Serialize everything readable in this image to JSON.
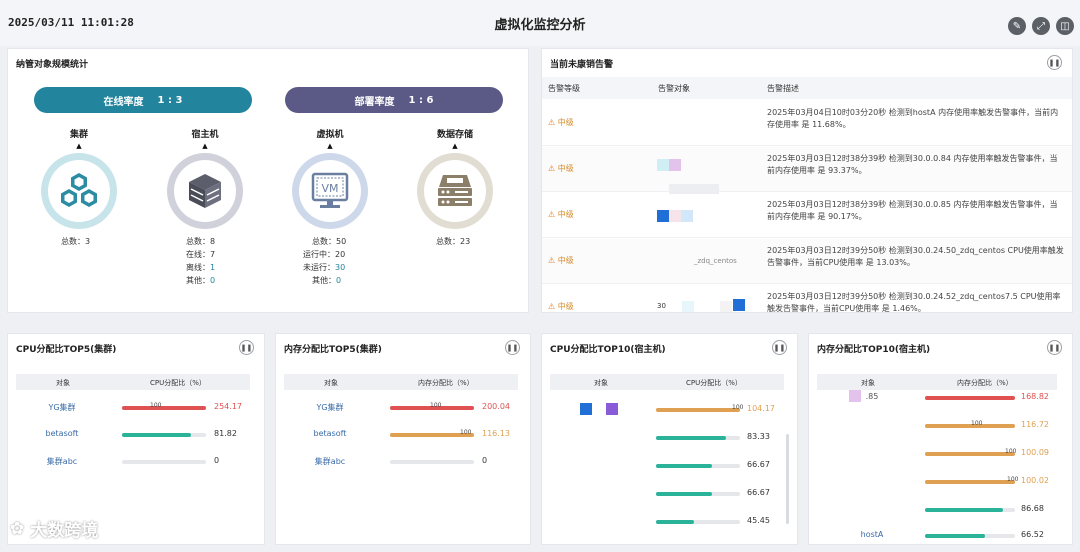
{
  "header": {
    "datetime": "2025/03/11 11:01:28",
    "title": "虚拟化监控分析",
    "icons": [
      "edit-icon",
      "fullscreen-icon",
      "layout-icon"
    ]
  },
  "stats": {
    "title": "纳管对象规模统计",
    "online_pill": {
      "label": "在线率度",
      "ratio": "1 : 3"
    },
    "deploy_pill": {
      "label": "部署率度",
      "ratio": "1 : 6"
    },
    "objects": [
      {
        "name": "集群",
        "icon": "cluster-icon",
        "lines": [
          {
            "k": "总数：",
            "v": "3"
          }
        ]
      },
      {
        "name": "宿主机",
        "icon": "host-icon",
        "lines": [
          {
            "k": "总数：",
            "v": "8"
          },
          {
            "k": "在线：",
            "v": "7"
          },
          {
            "k": "离线：",
            "v": "1"
          },
          {
            "k": "其他：",
            "v": "0"
          }
        ]
      },
      {
        "name": "虚拟机",
        "icon": "vm-icon",
        "vm_text": "VM",
        "lines": [
          {
            "k": "总数：",
            "v": "50"
          },
          {
            "k": "运行中：",
            "v": "20"
          },
          {
            "k": "未运行：",
            "v": "30"
          },
          {
            "k": "其他：",
            "v": "0"
          }
        ]
      },
      {
        "name": "数据存储",
        "icon": "storage-icon",
        "lines": [
          {
            "k": "总数：",
            "v": "23"
          }
        ]
      }
    ]
  },
  "alarms": {
    "title": "当前未康销告警",
    "columns": [
      "告警等级",
      "告警对象",
      "告警描述"
    ],
    "rows": [
      {
        "level": "中级",
        "object": "",
        "desc": "2025年03月04日10时03分20秒 检测到hostA 内存使用率触发告警事件，当前内存使用率 是 11.68%。"
      },
      {
        "level": "中级",
        "object": "",
        "desc": "2025年03月03日12时38分39秒 检测到30.0.0.84 内存使用率触发告警事件，当前内存使用率 是 93.37%。"
      },
      {
        "level": "中级",
        "object": "",
        "desc": "2025年03月03日12时38分39秒 检测到30.0.0.85 内存使用率触发告警事件，当前内存使用率 是 90.17%。"
      },
      {
        "level": "中级",
        "object": "_zdq_centos",
        "desc": "2025年03月03日12时39分50秒 检测到30.0.24.50_zdq_centos CPU使用率触发告警事件，当前CPU使用率 是 13.03%。"
      },
      {
        "level": "中级",
        "object": "30",
        "desc": "2025年03月03日12时39分50秒 检测到30.0.24.52_zdq_centos7.5 CPU使用率触发告警事件，当前CPU使用率 是 1.46%。"
      }
    ]
  },
  "cpu_cluster": {
    "title": "CPU分配比TOP5(集群)",
    "col_obj": "对象",
    "col_val": "CPU分配比（%）",
    "mark": "100",
    "rows": [
      {
        "name": "YG集群",
        "value": "254.17",
        "pct": 100,
        "color": "#e05252"
      },
      {
        "name": "betasoft",
        "value": "81.82",
        "pct": 82,
        "color": "#2bb39a"
      },
      {
        "name": "集群abc",
        "value": "0",
        "pct": 0,
        "color": "#e5e7eb"
      }
    ]
  },
  "mem_cluster": {
    "title": "内存分配比TOP5(集群)",
    "col_obj": "对象",
    "col_val": "内存分配比（%）",
    "mark": "100",
    "rows": [
      {
        "name": "YG集群",
        "value": "200.04",
        "pct": 100,
        "color": "#e05252"
      },
      {
        "name": "betasoft",
        "value": "116.13",
        "pct": 100,
        "color": "#e0a052"
      },
      {
        "name": "集群abc",
        "value": "0",
        "pct": 0,
        "color": "#e5e7eb"
      }
    ]
  },
  "cpu_host": {
    "title": "CPU分配比TOP10(宿主机)",
    "col_obj": "对象",
    "col_val": "CPU分配比（%）",
    "mark": "100",
    "rows": [
      {
        "name": "",
        "value": "104.17",
        "pct": 100,
        "color": "#e0a052"
      },
      {
        "name": "",
        "value": "83.33",
        "pct": 83,
        "color": "#2bb39a"
      },
      {
        "name": "",
        "value": "66.67",
        "pct": 67,
        "color": "#2bb39a"
      },
      {
        "name": "",
        "value": "66.67",
        "pct": 67,
        "color": "#2bb39a"
      },
      {
        "name": "",
        "value": "45.45",
        "pct": 45,
        "color": "#2bb39a"
      }
    ]
  },
  "mem_host": {
    "title": "内存分配比TOP10(宿主机)",
    "col_obj": "对象",
    "col_val": "内存分配比（%）",
    "mark": "100",
    "rows": [
      {
        "name": ".85",
        "value": "168.82",
        "pct": 100,
        "color": "#e05252"
      },
      {
        "name": "",
        "value": "116.72",
        "pct": 100,
        "color": "#e0a052"
      },
      {
        "name": "",
        "value": "100.09",
        "pct": 100,
        "color": "#e0a052"
      },
      {
        "name": "",
        "value": "100.02",
        "pct": 100,
        "color": "#e0a052"
      },
      {
        "name": "",
        "value": "86.68",
        "pct": 87,
        "color": "#2bb39a"
      },
      {
        "name": "hostA",
        "value": "66.52",
        "pct": 67,
        "color": "#2bb39a"
      }
    ]
  },
  "watermark": "大数跨境"
}
